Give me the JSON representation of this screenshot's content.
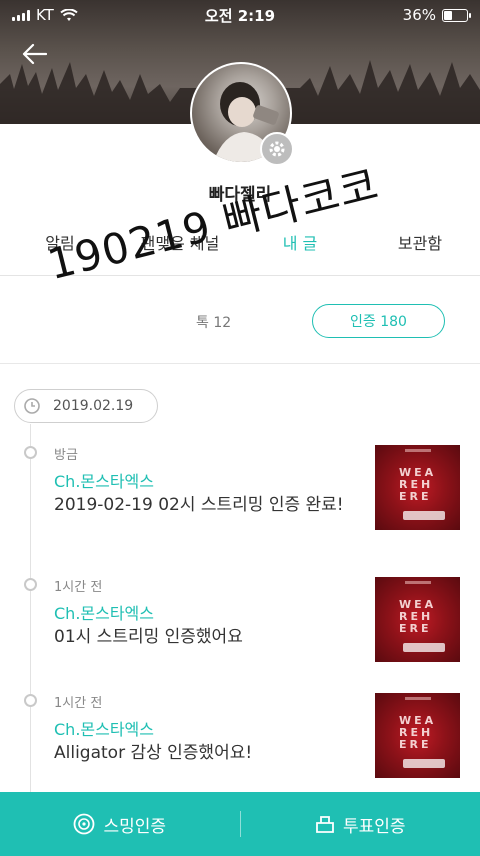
{
  "status_bar": {
    "carrier": "KT",
    "time": "오전 2:19",
    "battery_percent": "36%",
    "battery_level": 0.36
  },
  "profile": {
    "nickname": "빠다젤리"
  },
  "tabs": [
    {
      "label": "알림",
      "active": false
    },
    {
      "label": "팬맺은 채널",
      "active": false
    },
    {
      "label": "내 글",
      "active": true
    },
    {
      "label": "보관함",
      "active": false
    }
  ],
  "overlay_text": "190219 빠다코코",
  "summary": {
    "count_label": "톡 12",
    "cert_button_label": "인증 180"
  },
  "date_label": "2019.02.19",
  "items": [
    {
      "time": "방금",
      "channel": "Ch.몬스타엑스",
      "text": "2019-02-19 02시 스트리밍 인증 완료!",
      "thumb_title": "WEAREHERE"
    },
    {
      "time": "1시간 전",
      "channel": "Ch.몬스타엑스",
      "text": "01시 스트리밍 인증했어요",
      "thumb_title": "WEAREHERE"
    },
    {
      "time": "1시간 전",
      "channel": "Ch.몬스타엑스",
      "text": "Alligator 감상 인증했어요!",
      "thumb_title": "WEAREHERE"
    }
  ],
  "bottom_bar": {
    "left_label": "스밍인증",
    "right_label": "투표인증"
  },
  "colors": {
    "accent": "#1fbfb3",
    "album_red": "#c01b25"
  }
}
